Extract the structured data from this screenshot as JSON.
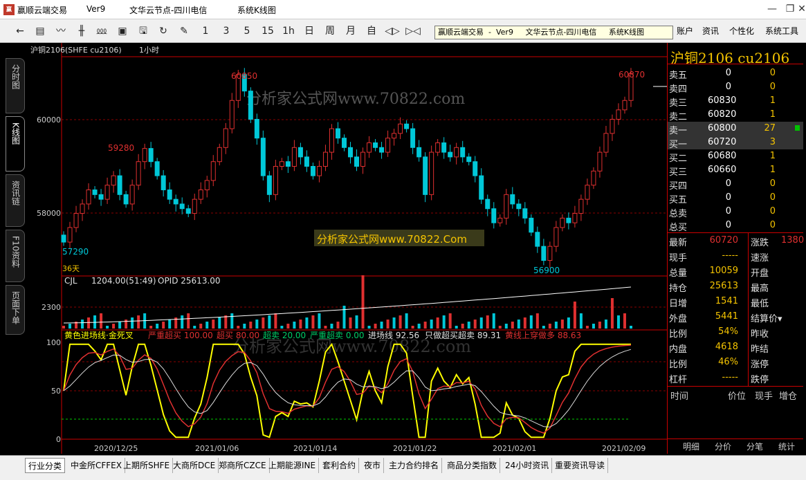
{
  "window": {
    "title": "赢顺云端交易",
    "version": "Ver9",
    "node": "文华云节点-四川电信",
    "view": "系统K线图"
  },
  "tooltip": {
    "app": "赢顺云端交易",
    "sep": "-",
    "version": "Ver9",
    "node": "文华云节点-四川电信",
    "view": "系统K线图"
  },
  "toolbar": {
    "buttons": [
      "1",
      "3",
      "5",
      "15",
      "1h",
      "日",
      "周",
      "月",
      "自"
    ],
    "menus": [
      "账户",
      "资讯",
      "个性化",
      "系统工具"
    ]
  },
  "left_tabs": [
    "分时图",
    "K线图",
    "资讯链",
    "F10资料",
    "页面下单"
  ],
  "chart_header": {
    "symbol": "沪铜2106(SHFE cu2106)",
    "period": "1小时"
  },
  "watermark": "分析家公式网www.70822.com",
  "watermark_box": "分析家公式网www.70822.Com",
  "price_labels": {
    "high1": "60850",
    "high2": "60870",
    "mid": "59280",
    "low1": "57290",
    "low2": "56900",
    "days": "36天"
  },
  "price_axis": [
    "60000",
    "58000"
  ],
  "volume": {
    "name": "CJL",
    "value": "1204.00(51:49)",
    "opid": "OPID 25613.00",
    "axis": "2300"
  },
  "indicator": {
    "name": "黄色进场线·金死叉",
    "items": [
      "严重超买 100.00",
      "超买 80.00",
      "超卖 20.00",
      "严重超卖 0.00",
      "进场线 92.56",
      "只做超买超卖 89.31",
      "黄线上穿做多 88.63"
    ],
    "axis": [
      "100",
      "50",
      "0"
    ]
  },
  "x_dates": [
    "2020/12/25",
    "2021/01/06",
    "2021/01/14",
    "2021/01/22",
    "2021/02/01",
    "2021/02/09"
  ],
  "quote": {
    "title": "沪铜2106  cu2106",
    "book": [
      {
        "label": "卖五",
        "price": "0",
        "vol": "0"
      },
      {
        "label": "卖四",
        "price": "0",
        "vol": "0"
      },
      {
        "label": "卖三",
        "price": "60830",
        "vol": "1"
      },
      {
        "label": "卖二",
        "price": "60820",
        "vol": "1"
      },
      {
        "label": "卖一",
        "price": "60800",
        "vol": "27"
      },
      {
        "label": "买一",
        "price": "60720",
        "vol": "3"
      },
      {
        "label": "买二",
        "price": "60680",
        "vol": "1"
      },
      {
        "label": "买三",
        "price": "60660",
        "vol": "1"
      },
      {
        "label": "买四",
        "price": "0",
        "vol": "0"
      },
      {
        "label": "买五",
        "price": "0",
        "vol": "0"
      },
      {
        "label": "总卖",
        "price": "0",
        "vol": "0"
      },
      {
        "label": "总买",
        "price": "0",
        "vol": "0"
      }
    ],
    "stats": [
      {
        "l1": "最新",
        "v1": "60720",
        "l2": "涨跌",
        "v2": "1380"
      },
      {
        "l1": "现手",
        "v1": "-----",
        "l2": "速涨",
        "v2": ""
      },
      {
        "l1": "总量",
        "v1": "10059",
        "l2": "开盘",
        "v2": ""
      },
      {
        "l1": "持仓",
        "v1": "25613",
        "l2": "最高",
        "v2": ""
      },
      {
        "l1": "日增",
        "v1": "1541",
        "l2": "最低",
        "v2": ""
      },
      {
        "l1": "外盘",
        "v1": "5441",
        "l2": "结算价▾",
        "v2": ""
      },
      {
        "l1": "比例",
        "v1": "54%",
        "l2": "昨收",
        "v2": ""
      },
      {
        "l1": "内盘",
        "v1": "4618",
        "l2": "昨结",
        "v2": ""
      },
      {
        "l1": "比例",
        "v1": "46%",
        "l2": "涨停",
        "v2": ""
      },
      {
        "l1": "杠杆",
        "v1": "-----",
        "l2": "跌停",
        "v2": ""
      }
    ],
    "trade_headers": [
      "时间",
      "价位",
      "现手",
      "增仓"
    ],
    "tabs": [
      "明细",
      "分价",
      "分笔",
      "统计"
    ]
  },
  "bottom_tabs": [
    "行业分类",
    "中金所CFFEX",
    "上期所SHFE",
    "大商所DCE",
    "郑商所CZCE",
    "上期能源INE",
    "套利合约",
    "夜市",
    "主力合约排名",
    "商品分类指数",
    "24小时资讯",
    "重要资讯导读"
  ],
  "colors": {
    "up": "#e03030",
    "down": "#00c8d8",
    "yellow": "#ffff00",
    "grid": "#8b0000",
    "accent": "#f5c400"
  },
  "chart_data": {
    "type": "candlestick",
    "ylim": [
      56600,
      61200
    ],
    "close": [
      57290,
      57600,
      57900,
      58100,
      58400,
      58300,
      58200,
      58500,
      58700,
      58300,
      58100,
      58500,
      59000,
      59280,
      59000,
      58700,
      58400,
      58200,
      58100,
      58000,
      57900,
      58200,
      58400,
      58600,
      59000,
      59300,
      59700,
      60300,
      60850,
      60500,
      59900,
      59500,
      58700,
      58300,
      58900,
      59000,
      58900,
      59300,
      59100,
      58900,
      58700,
      58900,
      59200,
      59700,
      59500,
      59300,
      59100,
      58900,
      59200,
      59400,
      59300,
      59200,
      59500,
      59600,
      59800,
      59700,
      59300,
      59100,
      58300,
      59200,
      59400,
      59200,
      59100,
      59300,
      59100,
      59000,
      58700,
      58200,
      58000,
      57700,
      57800,
      58300,
      58100,
      58000,
      57800,
      57500,
      57200,
      56900,
      57200,
      57600,
      57800,
      57700,
      57900,
      58200,
      58500,
      58800,
      59200,
      59600,
      59900,
      60100,
      60300,
      60870
    ]
  }
}
